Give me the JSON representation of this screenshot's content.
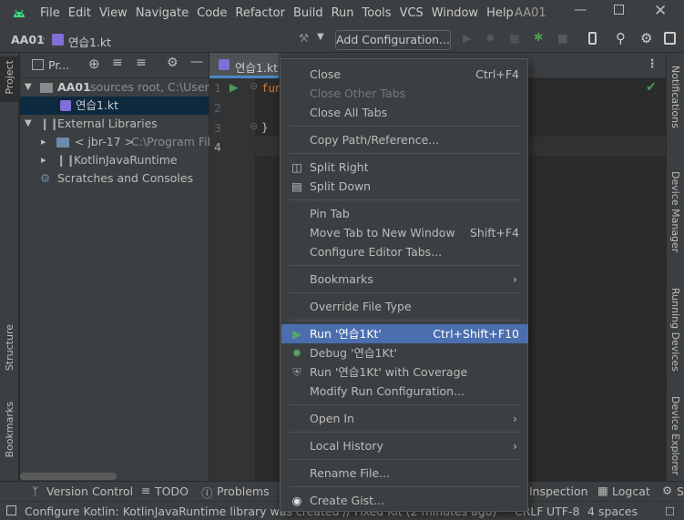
{
  "menu": [
    "File",
    "Edit",
    "View",
    "Navigate",
    "Code",
    "Refactor",
    "Build",
    "Run",
    "Tools",
    "VCS",
    "Window",
    "Help"
  ],
  "window_title": "AA01",
  "nav": {
    "project": "AA01",
    "file": "연습1.kt",
    "add_config": "Add Configuration..."
  },
  "project_panel": {
    "title": "Pr...",
    "tree": {
      "root": "AA01",
      "root_hint": "sources root,  C:\\Users\\",
      "file": "연습1.kt",
      "ext_libs": "External Libraries",
      "jbr": "< jbr-17 >",
      "jbr_path": "C:\\Program File",
      "kotlin": "KotlinJavaRuntime",
      "scratches": "Scratches and Consoles"
    }
  },
  "left_strip": {
    "project": "Project",
    "structure": "Structure",
    "bookmarks": "Bookmarks"
  },
  "right_strip": {
    "notifications": "Notifications",
    "device_manager": "Device Manager",
    "running_devices": "Running Devices",
    "device_explorer": "Device Explorer"
  },
  "editor": {
    "tab": "연습1.kt",
    "lines": [
      "1",
      "2",
      "3",
      "4"
    ],
    "code_fun": "fun",
    "code_brace": "}"
  },
  "context_menu": {
    "close": "Close",
    "close_sc": "Ctrl+F4",
    "close_other": "Close Other Tabs",
    "close_all": "Close All Tabs",
    "copy_path": "Copy Path/Reference...",
    "split_right": "Split Right",
    "split_down": "Split Down",
    "pin": "Pin Tab",
    "move_tab": "Move Tab to New Window",
    "move_tab_sc": "Shift+F4",
    "configure_tabs": "Configure Editor Tabs...",
    "bookmarks": "Bookmarks",
    "override": "Override File Type",
    "run": "Run '연습1Kt'",
    "run_sc": "Ctrl+Shift+F10",
    "debug": "Debug '연습1Kt'",
    "run_coverage": "Run '연습1Kt' with Coverage",
    "modify_run": "Modify Run Configuration...",
    "open_in": "Open In",
    "local_history": "Local History",
    "rename": "Rename File...",
    "gist": "Create Gist..."
  },
  "bottom_tabs": {
    "version_control": "Version Control",
    "todo": "TODO",
    "problems": "Problems",
    "inspection": "Inspection",
    "logcat": "Logcat",
    "se": "Se"
  },
  "status": {
    "message": "Configure Kotlin: KotlinJavaRuntime library was created // Fixed Kit (2 minutes ago)",
    "encoding": "UTF-8",
    "indent": "4 spaces",
    "line_sep": "CRLF"
  },
  "colors": {
    "accent": "#4b6eaf",
    "run_green": "#499c54",
    "bg_dark": "#2b2b2b",
    "bg_panel": "#3c3f41"
  }
}
